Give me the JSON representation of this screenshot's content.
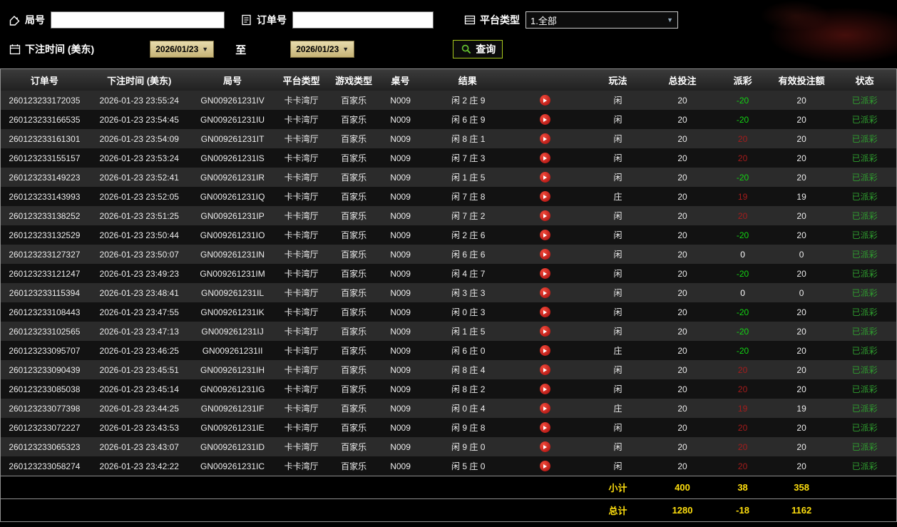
{
  "filters": {
    "round_label": "局号",
    "round_input_value": "",
    "order_label": "订单号",
    "order_input_value": "",
    "platform_label": "平台类型",
    "platform_value": "1.全部",
    "bet_time_label": "下注时间 (美东)",
    "date_from": "2026/01/23",
    "to_label": "至",
    "date_to": "2026/01/23",
    "search_label": "查询"
  },
  "icons": {
    "round": "tag-icon",
    "order": "document-icon",
    "platform": "list-icon",
    "bet_time": "calendar-icon",
    "search": "magnifier-icon",
    "result_row": "play-icon",
    "dropdown": "chevron-down-icon"
  },
  "colors": {
    "payout_negative": "#12d412",
    "payout_positive": "#a51c1c",
    "status_paid": "#2f9e2f",
    "summary_text": "#ffdf0e",
    "search_button_border": "#a9c91d",
    "date_button_bg": "#d6c48c",
    "row_odd": "#2b2b2b",
    "row_even": "#121212"
  },
  "table": {
    "headers": [
      "订单号",
      "下注时间 (美东)",
      "局号",
      "平台类型",
      "游戏类型",
      "桌号",
      "结果",
      "玩法",
      "总投注",
      "派彩",
      "有效投注额",
      "状态"
    ],
    "rows": [
      {
        "order_id": "260123233172035",
        "bet_time": "2026-01-23 23:55:24",
        "round_id": "GN009261231IV",
        "platform": "卡卡湾厅",
        "game_type": "百家乐",
        "table_no": "N009",
        "result": "闲 2 庄 9",
        "play": "闲",
        "total_bet": "20",
        "payout": "-20",
        "payout_color": "negative",
        "valid_bet": "20",
        "status": "已派彩"
      },
      {
        "order_id": "260123233166535",
        "bet_time": "2026-01-23 23:54:45",
        "round_id": "GN009261231IU",
        "platform": "卡卡湾厅",
        "game_type": "百家乐",
        "table_no": "N009",
        "result": "闲 6 庄 9",
        "play": "闲",
        "total_bet": "20",
        "payout": "-20",
        "payout_color": "negative",
        "valid_bet": "20",
        "status": "已派彩"
      },
      {
        "order_id": "260123233161301",
        "bet_time": "2026-01-23 23:54:09",
        "round_id": "GN009261231IT",
        "platform": "卡卡湾厅",
        "game_type": "百家乐",
        "table_no": "N009",
        "result": "闲 8 庄 1",
        "play": "闲",
        "total_bet": "20",
        "payout": "20",
        "payout_color": "positive",
        "valid_bet": "20",
        "status": "已派彩"
      },
      {
        "order_id": "260123233155157",
        "bet_time": "2026-01-23 23:53:24",
        "round_id": "GN009261231IS",
        "platform": "卡卡湾厅",
        "game_type": "百家乐",
        "table_no": "N009",
        "result": "闲 7 庄 3",
        "play": "闲",
        "total_bet": "20",
        "payout": "20",
        "payout_color": "positive",
        "valid_bet": "20",
        "status": "已派彩"
      },
      {
        "order_id": "260123233149223",
        "bet_time": "2026-01-23 23:52:41",
        "round_id": "GN009261231IR",
        "platform": "卡卡湾厅",
        "game_type": "百家乐",
        "table_no": "N009",
        "result": "闲 1 庄 5",
        "play": "闲",
        "total_bet": "20",
        "payout": "-20",
        "payout_color": "negative",
        "valid_bet": "20",
        "status": "已派彩"
      },
      {
        "order_id": "260123233143993",
        "bet_time": "2026-01-23 23:52:05",
        "round_id": "GN009261231IQ",
        "platform": "卡卡湾厅",
        "game_type": "百家乐",
        "table_no": "N009",
        "result": "闲 7 庄 8",
        "play": "庄",
        "total_bet": "20",
        "payout": "19",
        "payout_color": "positive",
        "valid_bet": "19",
        "status": "已派彩"
      },
      {
        "order_id": "260123233138252",
        "bet_time": "2026-01-23 23:51:25",
        "round_id": "GN009261231IP",
        "platform": "卡卡湾厅",
        "game_type": "百家乐",
        "table_no": "N009",
        "result": "闲 7 庄 2",
        "play": "闲",
        "total_bet": "20",
        "payout": "20",
        "payout_color": "positive",
        "valid_bet": "20",
        "status": "已派彩"
      },
      {
        "order_id": "260123233132529",
        "bet_time": "2026-01-23 23:50:44",
        "round_id": "GN009261231IO",
        "platform": "卡卡湾厅",
        "game_type": "百家乐",
        "table_no": "N009",
        "result": "闲 2 庄 6",
        "play": "闲",
        "total_bet": "20",
        "payout": "-20",
        "payout_color": "negative",
        "valid_bet": "20",
        "status": "已派彩"
      },
      {
        "order_id": "260123233127327",
        "bet_time": "2026-01-23 23:50:07",
        "round_id": "GN009261231IN",
        "platform": "卡卡湾厅",
        "game_type": "百家乐",
        "table_no": "N009",
        "result": "闲 6 庄 6",
        "play": "闲",
        "total_bet": "20",
        "payout": "0",
        "payout_color": "zero",
        "valid_bet": "0",
        "status": "已派彩"
      },
      {
        "order_id": "260123233121247",
        "bet_time": "2026-01-23 23:49:23",
        "round_id": "GN009261231IM",
        "platform": "卡卡湾厅",
        "game_type": "百家乐",
        "table_no": "N009",
        "result": "闲 4 庄 7",
        "play": "闲",
        "total_bet": "20",
        "payout": "-20",
        "payout_color": "negative",
        "valid_bet": "20",
        "status": "已派彩"
      },
      {
        "order_id": "260123233115394",
        "bet_time": "2026-01-23 23:48:41",
        "round_id": "GN009261231IL",
        "platform": "卡卡湾厅",
        "game_type": "百家乐",
        "table_no": "N009",
        "result": "闲 3 庄 3",
        "play": "闲",
        "total_bet": "20",
        "payout": "0",
        "payout_color": "zero",
        "valid_bet": "0",
        "status": "已派彩"
      },
      {
        "order_id": "260123233108443",
        "bet_time": "2026-01-23 23:47:55",
        "round_id": "GN009261231IK",
        "platform": "卡卡湾厅",
        "game_type": "百家乐",
        "table_no": "N009",
        "result": "闲 0 庄 3",
        "play": "闲",
        "total_bet": "20",
        "payout": "-20",
        "payout_color": "negative",
        "valid_bet": "20",
        "status": "已派彩"
      },
      {
        "order_id": "260123233102565",
        "bet_time": "2026-01-23 23:47:13",
        "round_id": "GN009261231IJ",
        "platform": "卡卡湾厅",
        "game_type": "百家乐",
        "table_no": "N009",
        "result": "闲 1 庄 5",
        "play": "闲",
        "total_bet": "20",
        "payout": "-20",
        "payout_color": "negative",
        "valid_bet": "20",
        "status": "已派彩"
      },
      {
        "order_id": "260123233095707",
        "bet_time": "2026-01-23 23:46:25",
        "round_id": "GN009261231II",
        "platform": "卡卡湾厅",
        "game_type": "百家乐",
        "table_no": "N009",
        "result": "闲 6 庄 0",
        "play": "庄",
        "total_bet": "20",
        "payout": "-20",
        "payout_color": "negative",
        "valid_bet": "20",
        "status": "已派彩"
      },
      {
        "order_id": "260123233090439",
        "bet_time": "2026-01-23 23:45:51",
        "round_id": "GN009261231IH",
        "platform": "卡卡湾厅",
        "game_type": "百家乐",
        "table_no": "N009",
        "result": "闲 8 庄 4",
        "play": "闲",
        "total_bet": "20",
        "payout": "20",
        "payout_color": "positive",
        "valid_bet": "20",
        "status": "已派彩"
      },
      {
        "order_id": "260123233085038",
        "bet_time": "2026-01-23 23:45:14",
        "round_id": "GN009261231IG",
        "platform": "卡卡湾厅",
        "game_type": "百家乐",
        "table_no": "N009",
        "result": "闲 8 庄 2",
        "play": "闲",
        "total_bet": "20",
        "payout": "20",
        "payout_color": "positive",
        "valid_bet": "20",
        "status": "已派彩"
      },
      {
        "order_id": "260123233077398",
        "bet_time": "2026-01-23 23:44:25",
        "round_id": "GN009261231IF",
        "platform": "卡卡湾厅",
        "game_type": "百家乐",
        "table_no": "N009",
        "result": "闲 0 庄 4",
        "play": "庄",
        "total_bet": "20",
        "payout": "19",
        "payout_color": "positive",
        "valid_bet": "19",
        "status": "已派彩"
      },
      {
        "order_id": "260123233072227",
        "bet_time": "2026-01-23 23:43:53",
        "round_id": "GN009261231IE",
        "platform": "卡卡湾厅",
        "game_type": "百家乐",
        "table_no": "N009",
        "result": "闲 9 庄 8",
        "play": "闲",
        "total_bet": "20",
        "payout": "20",
        "payout_color": "positive",
        "valid_bet": "20",
        "status": "已派彩"
      },
      {
        "order_id": "260123233065323",
        "bet_time": "2026-01-23 23:43:07",
        "round_id": "GN009261231ID",
        "platform": "卡卡湾厅",
        "game_type": "百家乐",
        "table_no": "N009",
        "result": "闲 9 庄 0",
        "play": "闲",
        "total_bet": "20",
        "payout": "20",
        "payout_color": "positive",
        "valid_bet": "20",
        "status": "已派彩"
      },
      {
        "order_id": "260123233058274",
        "bet_time": "2026-01-23 23:42:22",
        "round_id": "GN009261231IC",
        "platform": "卡卡湾厅",
        "game_type": "百家乐",
        "table_no": "N009",
        "result": "闲 5 庄 0",
        "play": "闲",
        "total_bet": "20",
        "payout": "20",
        "payout_color": "positive",
        "valid_bet": "20",
        "status": "已派彩"
      }
    ],
    "subtotal": {
      "label": "小计",
      "total_bet": "400",
      "payout": "38",
      "valid_bet": "358"
    },
    "total": {
      "label": "总计",
      "total_bet": "1280",
      "payout": "-18",
      "valid_bet": "1162"
    }
  }
}
